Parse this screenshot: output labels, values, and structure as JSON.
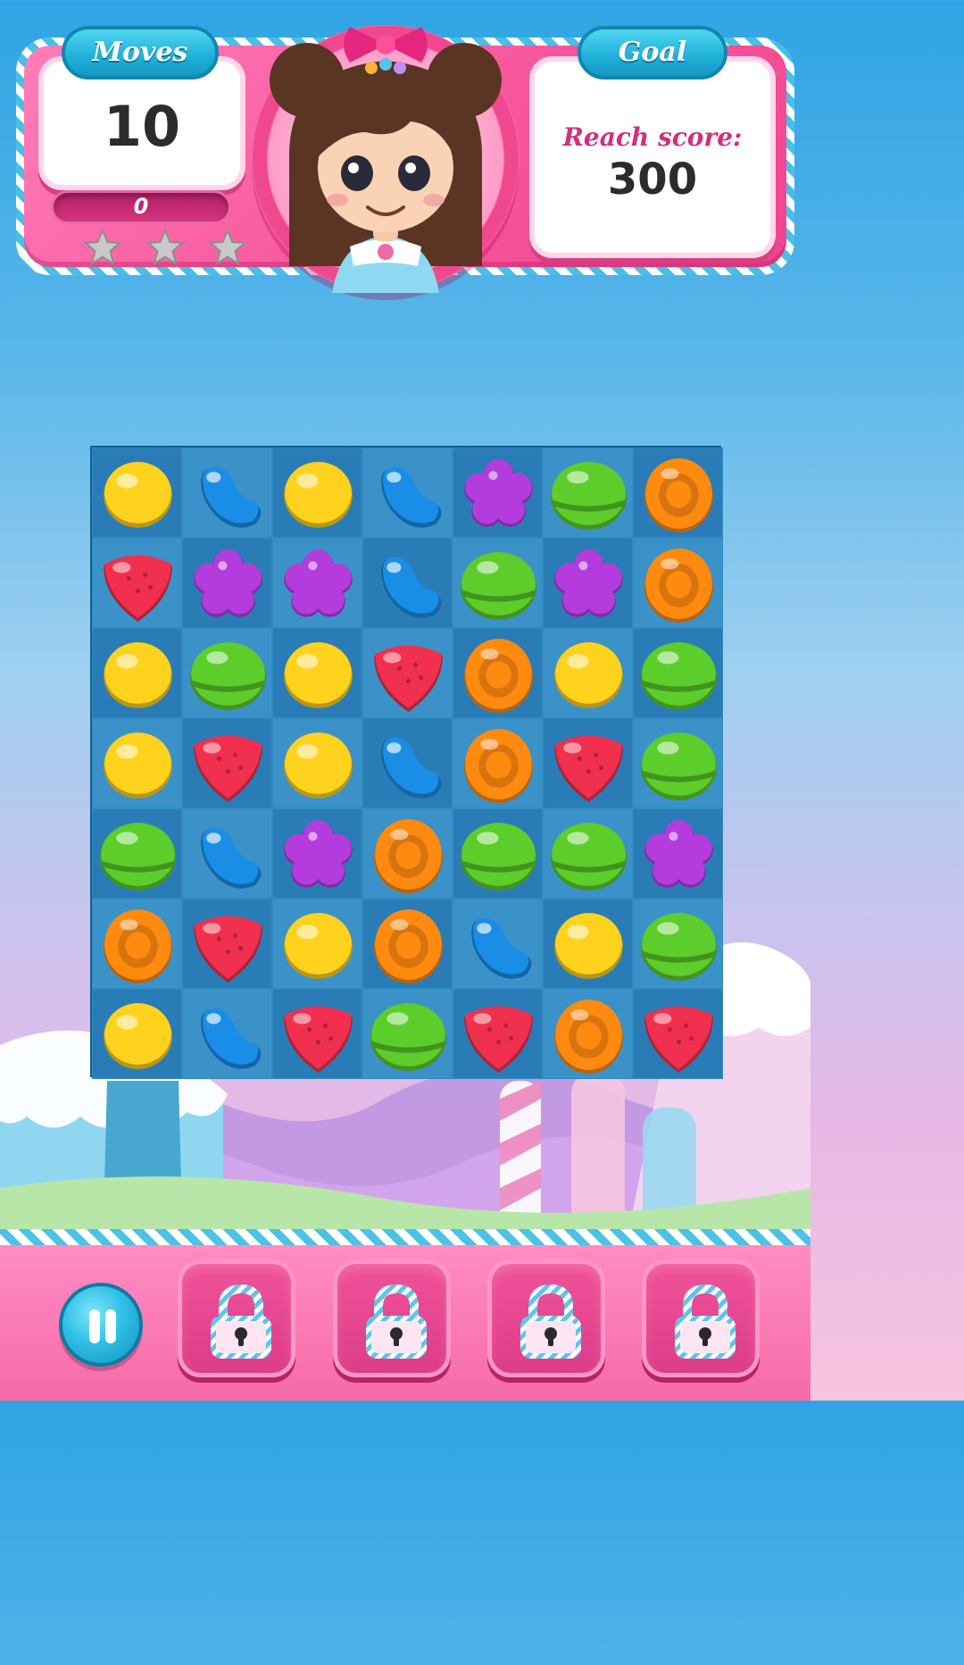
{
  "hud": {
    "moves_title": "Moves",
    "moves_value": "10",
    "score_value": "0",
    "stars": [
      {
        "name": "star-1-icon",
        "earned": false
      },
      {
        "name": "star-2-icon",
        "earned": false
      },
      {
        "name": "star-3-icon",
        "earned": false
      }
    ],
    "goal_title": "Goal",
    "goal_label": "Reach score:",
    "goal_value": "300",
    "avatar_icon": "girl-character-avatar-icon"
  },
  "board": {
    "rows": 7,
    "cols": 7,
    "grid": [
      [
        "yellow-lemon",
        "blue-jellybean",
        "yellow-lemon",
        "blue-jellybean",
        "purple-flower",
        "green-dome",
        "orange-disc"
      ],
      [
        "red-strawberry",
        "purple-flower",
        "purple-flower",
        "blue-jellybean",
        "green-dome",
        "purple-flower",
        "orange-disc"
      ],
      [
        "yellow-lemon",
        "green-dome",
        "yellow-lemon",
        "red-strawberry",
        "orange-disc",
        "yellow-lemon",
        "green-dome"
      ],
      [
        "yellow-lemon",
        "red-strawberry",
        "yellow-lemon",
        "blue-jellybean",
        "orange-disc",
        "red-strawberry",
        "green-dome"
      ],
      [
        "green-dome",
        "blue-jellybean",
        "purple-flower",
        "orange-disc",
        "green-dome",
        "green-dome",
        "purple-flower"
      ],
      [
        "orange-disc",
        "red-strawberry",
        "yellow-lemon",
        "orange-disc",
        "blue-jellybean",
        "yellow-lemon",
        "green-dome"
      ],
      [
        "yellow-lemon",
        "blue-jellybean",
        "red-strawberry",
        "green-dome",
        "red-strawberry",
        "orange-disc",
        "red-strawberry"
      ]
    ]
  },
  "colors": {
    "yellow-lemon": "#ffd21e",
    "blue-jellybean": "#1a8ee6",
    "purple-flower": "#b43cdc",
    "green-dome": "#5ccd2a",
    "orange-disc": "#ff8a10",
    "red-strawberry": "#f0304e",
    "hud_pink": "#f7569c",
    "title_cyan": "#1fb0d8"
  },
  "controls": {
    "pause_icon": "pause-icon",
    "boosters": [
      {
        "name": "booster-slot-1",
        "state": "locked",
        "icon": "lock-icon"
      },
      {
        "name": "booster-slot-2",
        "state": "locked",
        "icon": "lock-icon"
      },
      {
        "name": "booster-slot-3",
        "state": "locked",
        "icon": "lock-icon"
      },
      {
        "name": "booster-slot-4",
        "state": "locked",
        "icon": "lock-icon"
      }
    ]
  }
}
